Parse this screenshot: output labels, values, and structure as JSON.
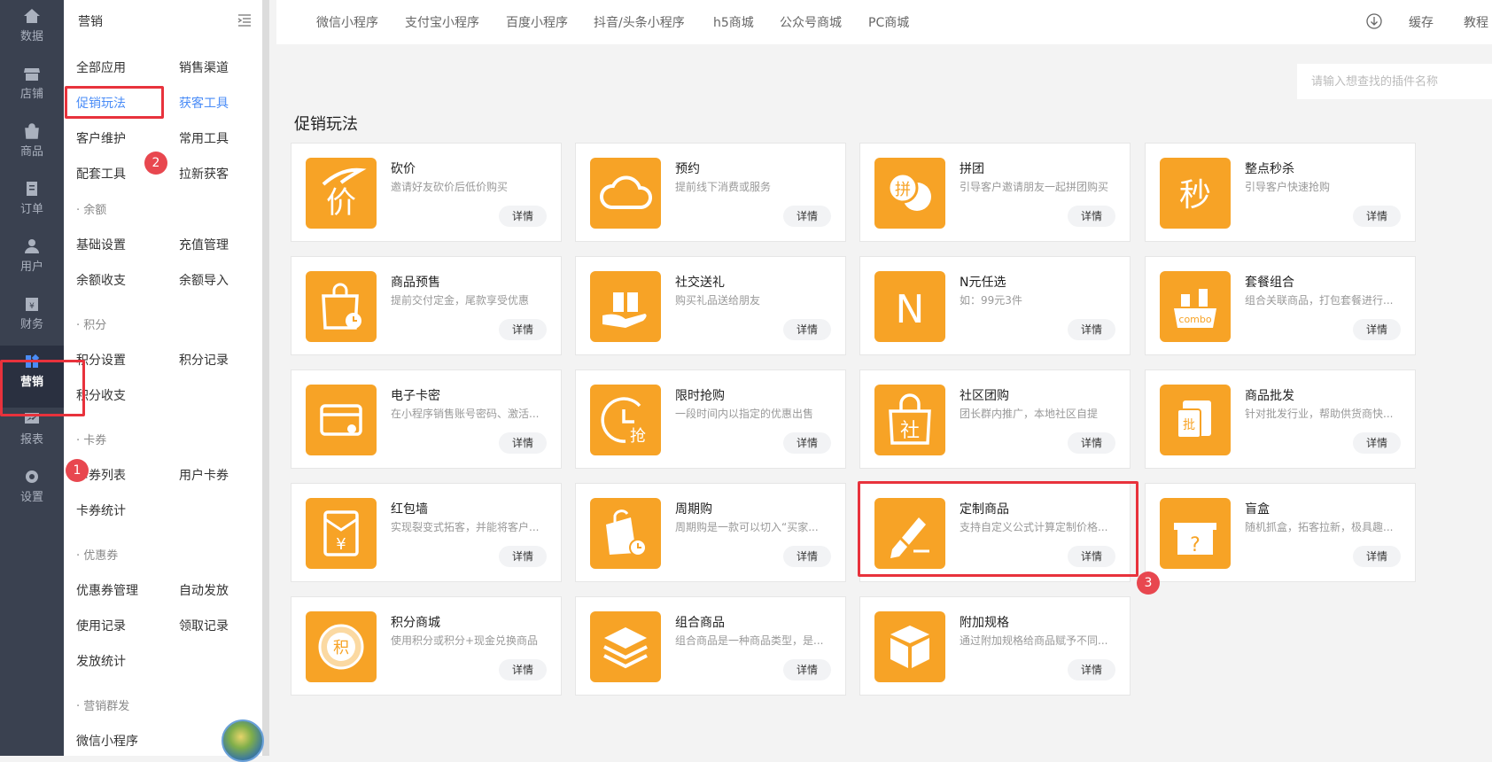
{
  "rail": [
    {
      "label": "数据",
      "icon": "home-icon"
    },
    {
      "label": "店铺",
      "icon": "store-icon"
    },
    {
      "label": "商品",
      "icon": "bag-icon"
    },
    {
      "label": "订单",
      "icon": "document-icon"
    },
    {
      "label": "用户",
      "icon": "user-icon"
    },
    {
      "label": "财务",
      "icon": "finance-icon"
    },
    {
      "label": "营销",
      "icon": "apps-icon"
    },
    {
      "label": "报表",
      "icon": "chart-icon"
    },
    {
      "label": "设置",
      "icon": "gear-icon"
    }
  ],
  "submenu": {
    "title": "营销",
    "items": [
      "全部应用",
      "销售渠道",
      "促销玩法",
      "获客工具",
      "客户维护",
      "常用工具",
      "配套工具",
      "拉新获客"
    ],
    "groups": {
      "balance": {
        "title": "· 余额",
        "items": [
          "基础设置",
          "充值管理",
          "余额收支",
          "余额导入"
        ]
      },
      "points": {
        "title": "· 积分",
        "items": [
          "积分设置",
          "积分记录",
          "积分收支"
        ]
      },
      "cards": {
        "title": "· 卡券",
        "items": [
          "卡券列表",
          "用户卡券",
          "卡券统计"
        ]
      },
      "coupons": {
        "title": "· 优惠券",
        "items": [
          "优惠券管理",
          "自动发放",
          "使用记录",
          "领取记录",
          "发放统计"
        ]
      },
      "mass": {
        "title": "· 营销群发",
        "items": [
          "微信小程序"
        ]
      }
    }
  },
  "topnav": {
    "tabs": [
      "微信小程序",
      "支付宝小程序",
      "百度小程序",
      "抖音/头条小程序",
      "h5商城",
      "公众号商城",
      "PC商城"
    ],
    "cache": "缓存",
    "tutorial": "教程"
  },
  "search": {
    "placeholder": "请输入想查找的插件名称"
  },
  "section_title": "促销玩法",
  "detail_label": "详情",
  "cards": [
    {
      "name": "砍价",
      "desc": "邀请好友砍价后低价购买",
      "glyph": "价"
    },
    {
      "name": "预约",
      "desc": "提前线下消费或服务",
      "glyph": ""
    },
    {
      "name": "拼团",
      "desc": "引导客户邀请朋友一起拼团购买",
      "glyph": "拼"
    },
    {
      "name": "整点秒杀",
      "desc": "引导客户快速抢购",
      "glyph": "秒"
    },
    {
      "name": "商品预售",
      "desc": "提前交付定金，尾款享受优惠",
      "glyph": ""
    },
    {
      "name": "社交送礼",
      "desc": "购买礼品送给朋友",
      "glyph": ""
    },
    {
      "name": "N元任选",
      "desc": "如：99元3件",
      "glyph": "N"
    },
    {
      "name": "套餐组合",
      "desc": "组合关联商品，打包套餐进行...",
      "glyph": "combo"
    },
    {
      "name": "电子卡密",
      "desc": "在小程序销售账号密码、激活...",
      "glyph": ""
    },
    {
      "name": "限时抢购",
      "desc": "一段时间内以指定的优惠出售",
      "glyph": "抢"
    },
    {
      "name": "社区团购",
      "desc": "团长群内推广，本地社区自提",
      "glyph": "社"
    },
    {
      "name": "商品批发",
      "desc": "针对批发行业，帮助供货商快...",
      "glyph": "批"
    },
    {
      "name": "红包墙",
      "desc": "实现裂变式拓客，并能将客户...",
      "glyph": "¥"
    },
    {
      "name": "周期购",
      "desc": "周期购是一款可以切入“买家...",
      "glyph": ""
    },
    {
      "name": "定制商品",
      "desc": "支持自定义公式计算定制价格...",
      "glyph": ""
    },
    {
      "name": "盲盒",
      "desc": "随机抓盒，拓客拉新，极具趣...",
      "glyph": "?"
    },
    {
      "name": "积分商城",
      "desc": "使用积分或积分+现金兑换商品",
      "glyph": "积"
    },
    {
      "name": "组合商品",
      "desc": "组合商品是一种商品类型，是...",
      "glyph": ""
    },
    {
      "name": "附加规格",
      "desc": "通过附加规格给商品赋予不同...",
      "glyph": ""
    }
  ],
  "badges": [
    "1",
    "2",
    "3"
  ],
  "colors": {
    "accent": "#4a8cf7",
    "icon_bg": "#f7a326",
    "highlight": "#e8323c"
  }
}
